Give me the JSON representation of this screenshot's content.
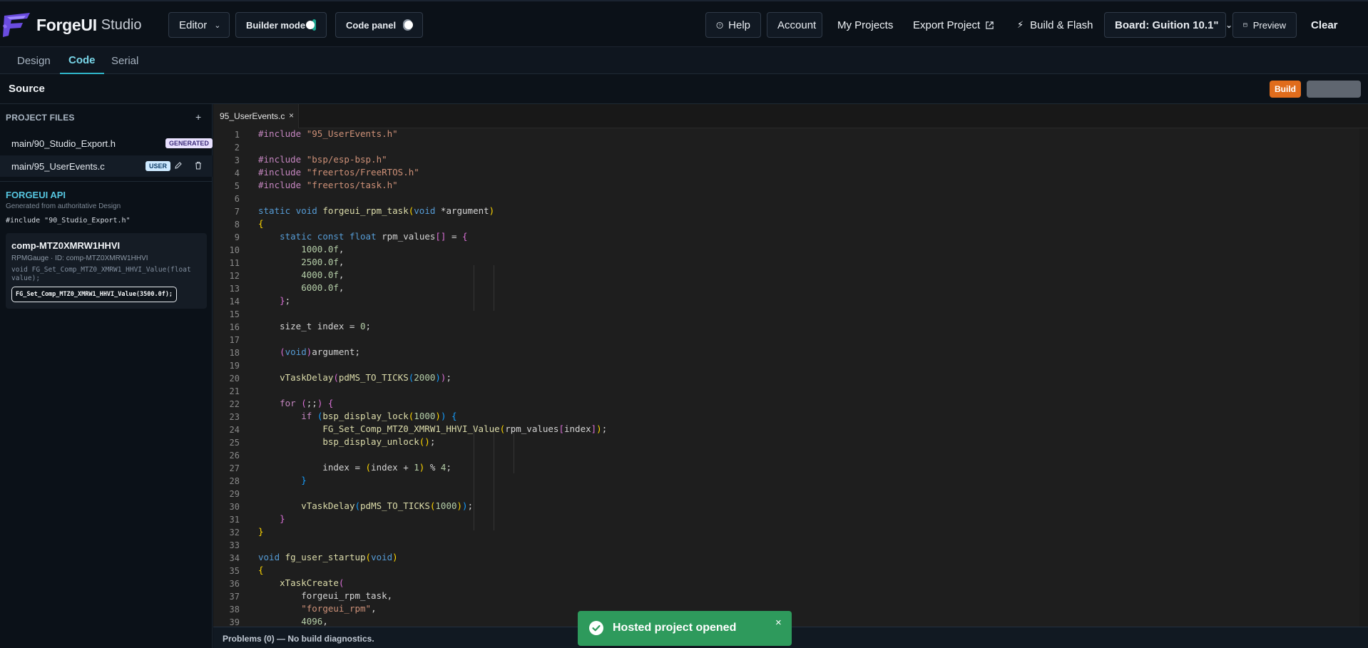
{
  "app": {
    "logo_text": "ForgeUI",
    "logo_sub": "Studio"
  },
  "toolbar": {
    "editor_label": "Editor",
    "builder_mode_label": "Builder mode",
    "builder_mode_on": true,
    "code_panel_label": "Code panel",
    "code_panel_on": false,
    "help_label": "Help",
    "account_label": "Account",
    "my_projects_label": "My Projects",
    "export_label": "Export Project",
    "build_flash_label": "Build & Flash",
    "board_label": "Board: Guition 10.1\"",
    "preview_label": "Preview",
    "clear_label": "Clear"
  },
  "tabs": [
    {
      "label": "Design",
      "active": false
    },
    {
      "label": "Code",
      "active": true
    },
    {
      "label": "Serial",
      "active": false
    }
  ],
  "source": {
    "title": "Source",
    "build_label": "Build"
  },
  "sidebar": {
    "project_files_title": "PROJECT FILES",
    "add_label": "+",
    "files": [
      {
        "name": "main/90_Studio_Export.h",
        "badge": "GENERATED"
      },
      {
        "name": "main/95_UserEvents.c",
        "badge": "USER"
      }
    ],
    "api_title": "FORGEUI API",
    "api_subtitle": "Generated from authoritative Design",
    "api_include": "#include \"90_Studio_Export.h\"",
    "component": {
      "name": "comp-MTZ0XMRW1HHVI",
      "meta": "RPMGauge · ID: comp-MTZ0XMRW1HHVI",
      "signature": "void FG_Set_Comp_MTZ0_XMRW1_HHVI_Value(float value);",
      "call": "FG_Set_Comp_MTZ0_XMRW1_HHVI_Value(3500.0f);"
    }
  },
  "editor": {
    "tab_label": "95_UserEvents.c",
    "tab_close": "×",
    "line_numbers": [
      "1",
      "2",
      "3",
      "4",
      "5",
      "6",
      "7",
      "8",
      "9",
      "10",
      "11",
      "12",
      "13",
      "14",
      "15",
      "16",
      "17",
      "18",
      "19",
      "20",
      "21",
      "22",
      "23",
      "24",
      "25",
      "26",
      "27",
      "28",
      "29",
      "30",
      "31",
      "32",
      "33",
      "34",
      "35",
      "36",
      "37",
      "38",
      "39"
    ]
  },
  "problems": {
    "text": "Problems (0) — No build diagnostics."
  },
  "toast": {
    "text": "Hosted project opened",
    "close": "×"
  },
  "colors": {
    "accent": "#2fb5c8",
    "build": "#e06c1c",
    "toast": "#2e9a5c",
    "toggle_on": "#1aa58f"
  }
}
